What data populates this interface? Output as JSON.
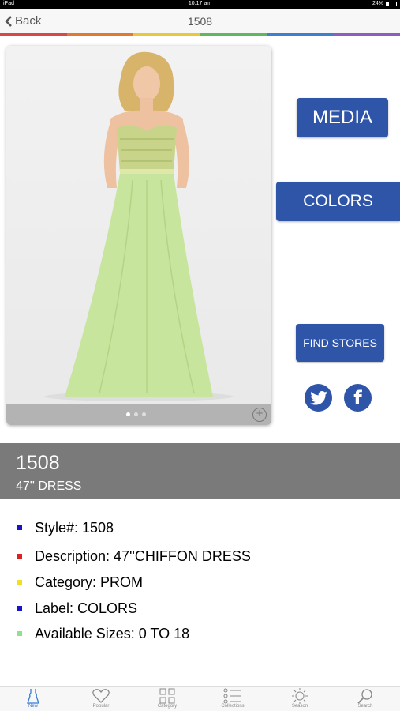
{
  "status_bar": {
    "device": "iPad",
    "time": "10:17 am",
    "battery": "24%"
  },
  "nav": {
    "back_label": "Back",
    "title": "1508"
  },
  "actions": {
    "media_label": "MEDIA",
    "colors_label": "COLORS",
    "find_stores_label": "FIND STORES",
    "facebook_glyph": "f"
  },
  "gallery": {
    "page_count": 3,
    "current_page": 1,
    "zoom_glyph": "+"
  },
  "product": {
    "style_number": "1508",
    "subtitle": "47'' DRESS",
    "details": [
      {
        "text": "Style#: 1508",
        "bullet_color": "#1515c8"
      },
      {
        "text": "Description: 47''CHIFFON DRESS",
        "bullet_color": "#e02020"
      },
      {
        "text": "Category: PROM",
        "bullet_color": "#f0e020"
      },
      {
        "text": "Label: COLORS",
        "bullet_color": "#1515c8"
      },
      {
        "text": "Available Sizes: 0 TO 18",
        "bullet_color": "#8fe08f"
      }
    ]
  },
  "colors": {
    "accent": "#2f55a8",
    "band": "#7a7a7a",
    "strip": [
      "#d94848",
      "#e07a2f",
      "#e8c93a",
      "#5fb85f",
      "#3f7fd0",
      "#8a5fc0"
    ]
  },
  "tab_bar": {
    "tabs": [
      {
        "label": "New",
        "icon": "dress-icon",
        "active": true
      },
      {
        "label": "Popular",
        "icon": "heart-icon",
        "active": false
      },
      {
        "label": "Category",
        "icon": "grid-icon",
        "active": false
      },
      {
        "label": "Collections",
        "icon": "list-icon",
        "active": false
      },
      {
        "label": "Season",
        "icon": "sun-icon",
        "active": false
      },
      {
        "label": "Search",
        "icon": "search-icon",
        "active": false
      }
    ]
  }
}
